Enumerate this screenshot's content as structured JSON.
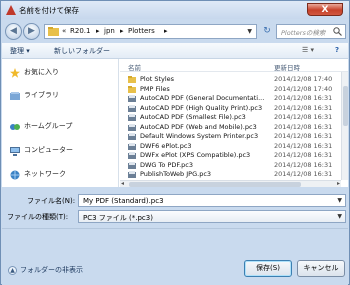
{
  "title": "名前を付けて保存",
  "close_label": "X",
  "address": {
    "segments": [
      "«",
      "R20.1",
      "▸",
      "jpn",
      "▸",
      "Plotters",
      "▸"
    ]
  },
  "search": {
    "placeholder": "Plottersの検索"
  },
  "toolbar": {
    "organize": "整理 ▾",
    "new_folder": "新しいフォルダー",
    "view": "☰ ▾",
    "help": "?"
  },
  "nav": {
    "items": [
      {
        "label": "お気に入り",
        "icon": "star-icon"
      },
      {
        "label": "ライブラリ",
        "icon": "library-icon"
      },
      {
        "label": "ホームグループ",
        "icon": "homegroup-icon"
      },
      {
        "label": "コンピューター",
        "icon": "computer-icon"
      },
      {
        "label": "ネットワーク",
        "icon": "network-icon"
      }
    ]
  },
  "columns": {
    "name": "名前",
    "date": "更新日時"
  },
  "files": [
    {
      "name": "Plot Styles",
      "date": "2014/12/08 17:40",
      "type": "folder"
    },
    {
      "name": "PMP Files",
      "date": "2014/12/08 17:40",
      "type": "folder"
    },
    {
      "name": "AutoCAD PDF (General Documentati...",
      "date": "2014/12/08 16:31",
      "type": "pc3"
    },
    {
      "name": "AutoCAD PDF (High Quality Print).pc3",
      "date": "2014/12/08 16:31",
      "type": "pc3"
    },
    {
      "name": "AutoCAD PDF (Smallest File).pc3",
      "date": "2014/12/08 16:31",
      "type": "pc3"
    },
    {
      "name": "AutoCAD PDF (Web and Mobile).pc3",
      "date": "2014/12/08 16:31",
      "type": "pc3"
    },
    {
      "name": "Default Windows System Printer.pc3",
      "date": "2014/12/08 16:31",
      "type": "pc3"
    },
    {
      "name": "DWF6 ePlot.pc3",
      "date": "2014/12/08 16:31",
      "type": "pc3"
    },
    {
      "name": "DWFx ePlot (XPS Compatible).pc3",
      "date": "2014/12/08 16:31",
      "type": "pc3"
    },
    {
      "name": "DWG To PDF.pc3",
      "date": "2014/12/08 16:31",
      "type": "pc3"
    },
    {
      "name": "PublishToWeb JPG.pc3",
      "date": "2014/12/08 16:31",
      "type": "pc3"
    }
  ],
  "form": {
    "filename_label": "ファイル名(N):",
    "filename_value": "My PDF (Standard).pc3",
    "filetype_label": "ファイルの種類(T):",
    "filetype_value": "PC3 ファイル (*.pc3)"
  },
  "footer": {
    "hide_folders": "フォルダーの非表示",
    "save": "保存(S)",
    "cancel": "キャンセル"
  },
  "colors": {
    "title_icon": "#c0392b",
    "folder": "#e8c04a",
    "accent": "#3c7fb1"
  }
}
